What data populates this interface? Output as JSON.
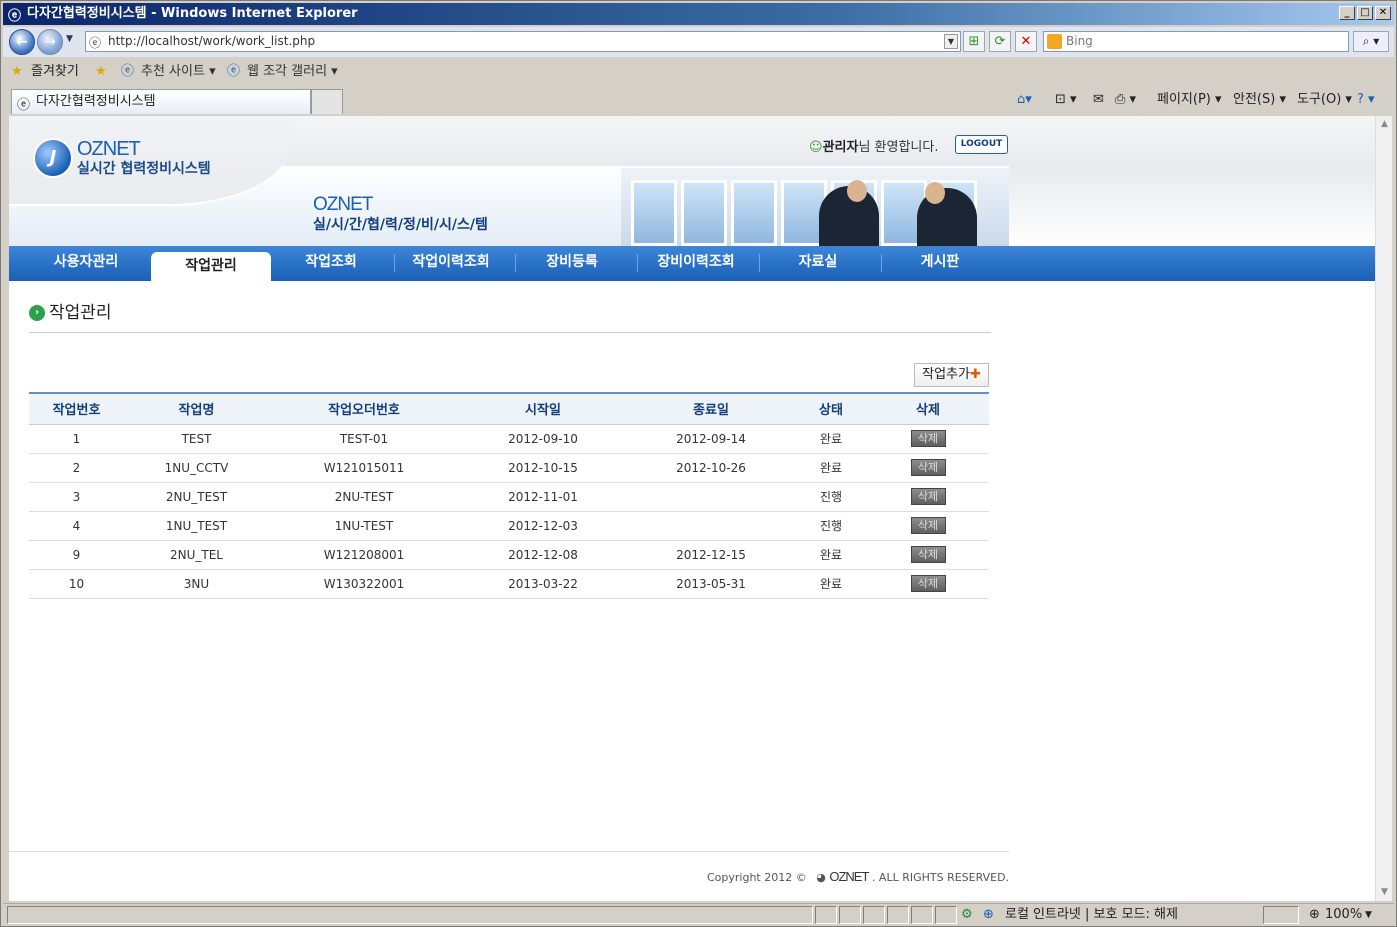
{
  "window": {
    "title": "다자간협력정비시스템 - Windows Internet Explorer",
    "min": "_",
    "max": "□",
    "close": "✕"
  },
  "browser": {
    "url": "http://localhost/work/work_list.php",
    "search_placeholder": "Bing",
    "favorites": "즐겨찾기",
    "fav_items": [
      "추천 사이트 ▾",
      "웹 조각 갤러리 ▾"
    ],
    "tab_title": "다자간협력정비시스템",
    "commands": [
      "페이지(P) ▾",
      "안전(S) ▾",
      "도구(O) ▾"
    ],
    "status_zone": "로컬 인트라넷 | 보호 모드: 해제",
    "zoom": "100%"
  },
  "site": {
    "logo_brand": "OZNET",
    "logo_sub": "실시간 협력정비시스템",
    "banner_brand": "OZNET",
    "banner_sub": "실/시/간/협/력/정/비/시/스/템",
    "welcome_user": "관리자",
    "welcome_rest": "님 환영합니다.",
    "logout": "LOGOUT"
  },
  "menu": [
    "사용자관리",
    "작업관리",
    "작업조회",
    "작업이력조회",
    "장비등록",
    "장비이력조회",
    "자료실",
    "게시판"
  ],
  "page": {
    "title": "작업관리",
    "add_button": "작업추가",
    "columns": [
      "작업번호",
      "작업명",
      "작업오더번호",
      "시작일",
      "종료일",
      "상태",
      "삭제"
    ],
    "rows": [
      {
        "no": "1",
        "name": "TEST",
        "order": "TEST-01",
        "start": "2012-09-10",
        "end": "2012-09-14",
        "status": "완료",
        "del": "삭제"
      },
      {
        "no": "2",
        "name": "1NU_CCTV",
        "order": "W121015011",
        "start": "2012-10-15",
        "end": "2012-10-26",
        "status": "완료",
        "del": "삭제"
      },
      {
        "no": "3",
        "name": "2NU_TEST",
        "order": "2NU-TEST",
        "start": "2012-11-01",
        "end": "",
        "status": "진행",
        "del": "삭제"
      },
      {
        "no": "4",
        "name": "1NU_TEST",
        "order": "1NU-TEST",
        "start": "2012-12-03",
        "end": "",
        "status": "진행",
        "del": "삭제"
      },
      {
        "no": "9",
        "name": "2NU_TEL",
        "order": "W121208001",
        "start": "2012-12-08",
        "end": "2012-12-15",
        "status": "완료",
        "del": "삭제"
      },
      {
        "no": "10",
        "name": "3NU",
        "order": "W130322001",
        "start": "2013-03-22",
        "end": "2013-05-31",
        "status": "완료",
        "del": "삭제"
      }
    ]
  },
  "footer": {
    "copyright": "Copyright 2012 ©",
    "brand": "OZNET",
    "rights": ". ALL RIGHTS RESERVED."
  }
}
